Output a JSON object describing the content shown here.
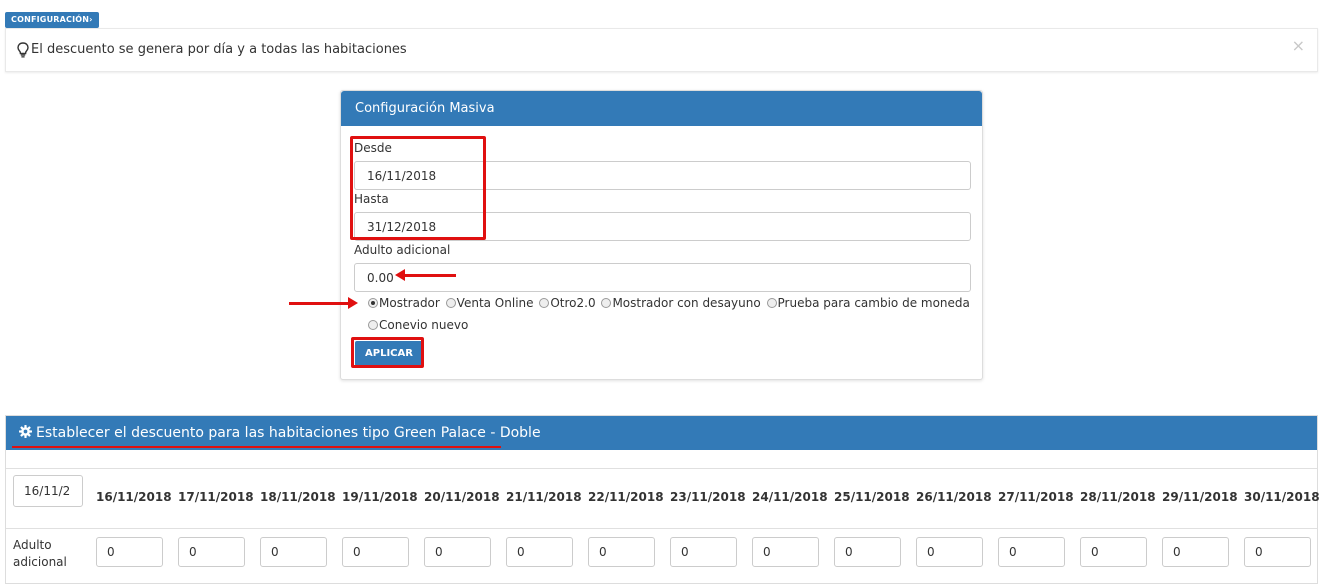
{
  "breadcrumb": {
    "label": "CONFIGURACIÓN"
  },
  "alert": {
    "message": "El descuento se genera por día y a todas las habitaciones",
    "close": "×"
  },
  "masiva": {
    "title": "Configuración Masiva",
    "desde_label": "Desde",
    "desde_value": "16/11/2018",
    "hasta_label": "Hasta",
    "hasta_value": "31/12/2018",
    "adulto_label": "Adulto adicional",
    "adulto_value": "0.00",
    "radios": [
      "Mostrador",
      "Venta Online",
      "Otro2.0",
      "Mostrador con desayuno",
      "Prueba para cambio de moneda",
      "Conevio nuevo"
    ],
    "selected_radio": "Mostrador",
    "apply_label": "APLICAR"
  },
  "descuento": {
    "title": "Establecer el descuento para las habitaciones tipo Green Palace - Doble",
    "date_select": "16/11/2",
    "dates": [
      "16/11/2018",
      "17/11/2018",
      "18/11/2018",
      "19/11/2018",
      "20/11/2018",
      "21/11/2018",
      "22/11/2018",
      "23/11/2018",
      "24/11/2018",
      "25/11/2018",
      "26/11/2018",
      "27/11/2018",
      "28/11/2018",
      "29/11/2018",
      "30/11/2018"
    ],
    "row_label_1": "Adulto",
    "row_label_2": "adicional",
    "values": [
      "0",
      "0",
      "0",
      "0",
      "0",
      "0",
      "0",
      "0",
      "0",
      "0",
      "0",
      "0",
      "0",
      "0",
      "0"
    ]
  },
  "colors": {
    "primary": "#337ab7",
    "annotation": "#e01010"
  }
}
